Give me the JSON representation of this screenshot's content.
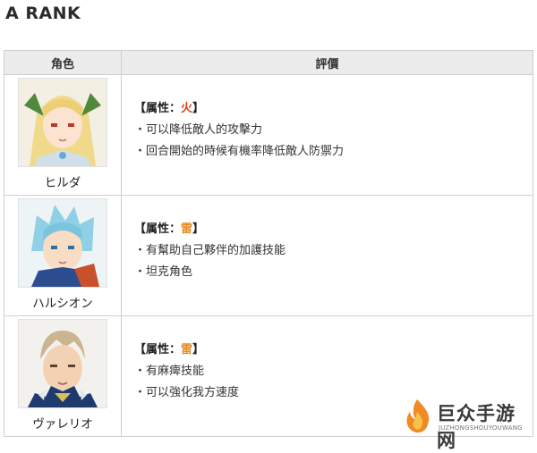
{
  "section": {
    "title": "A RANK"
  },
  "table": {
    "headers": {
      "character": "角色",
      "evaluation": "評價"
    },
    "rows": [
      {
        "name": "ヒルダ",
        "attr_label": "【属性：",
        "attr_value": "火",
        "attr_close": "】",
        "attr_color": "#d9411b",
        "bullets": [
          "・可以降低敵人的攻擊力",
          "・回合開始的時候有機率降低敵人防禦力"
        ]
      },
      {
        "name": "ハルシオン",
        "attr_label": "【属性：",
        "attr_value": "雷",
        "attr_close": "】",
        "attr_color": "#e8891d",
        "bullets": [
          "・有幫助自己夥伴的加護技能",
          "・坦克角色"
        ]
      },
      {
        "name": "ヴァレリオ",
        "attr_label": "【属性：",
        "attr_value": "雷",
        "attr_close": "】",
        "attr_color": "#e8891d",
        "bullets": [
          "・有麻痺技能",
          "・可以強化我方速度"
        ]
      }
    ]
  },
  "watermark": {
    "text": "巨众手游网",
    "sub": "JUZHONGSHOUYOUWANG"
  }
}
